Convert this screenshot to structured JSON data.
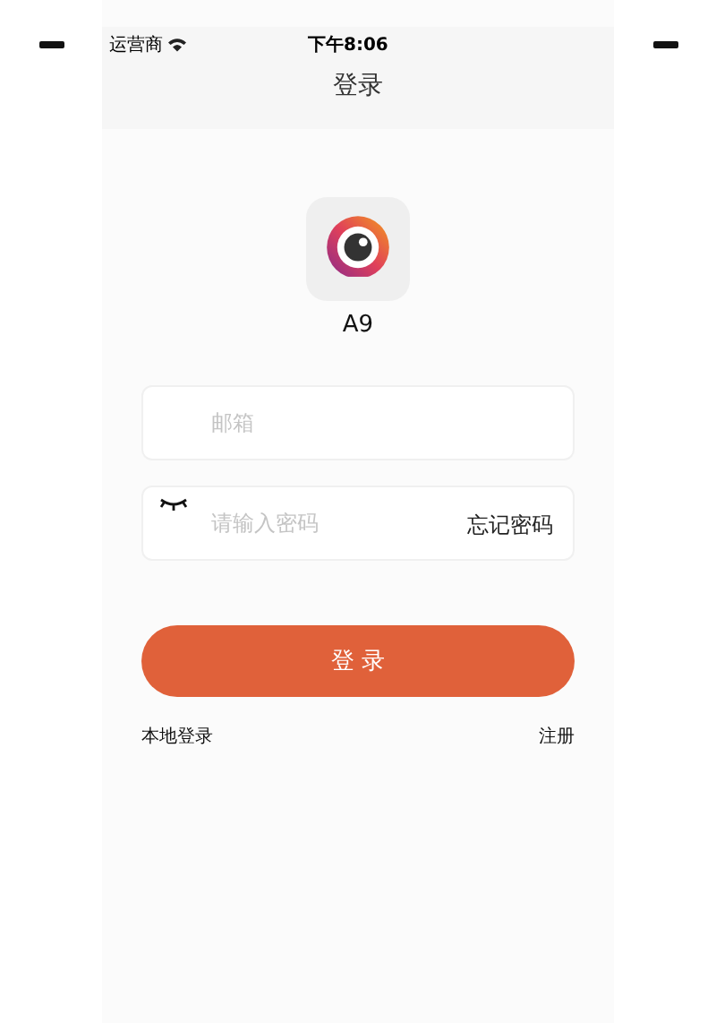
{
  "status_bar": {
    "carrier": "运营商",
    "time": "下午8:06"
  },
  "nav": {
    "title": "登录"
  },
  "app": {
    "name": "A9"
  },
  "fields": [
    {
      "kind": "email",
      "placeholder": "邮箱"
    },
    {
      "kind": "password",
      "placeholder": "请输入密码",
      "action": "忘记密码"
    }
  ],
  "login_button": "登 录",
  "links": [
    "本地登录",
    "注册"
  ]
}
